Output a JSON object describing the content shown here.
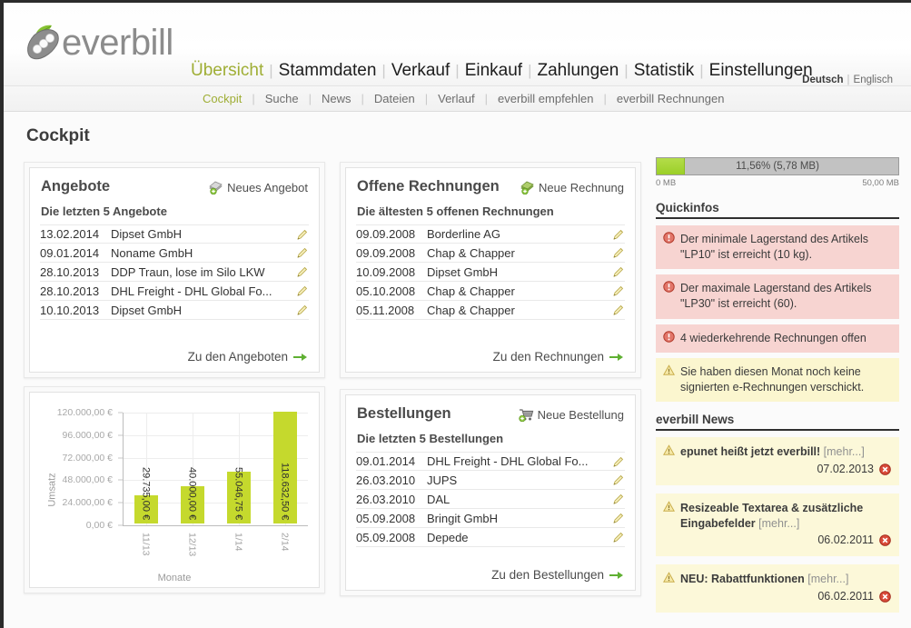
{
  "brand": {
    "logo_text": "everbill",
    "logo_icon": "pea-pod-logo-icon"
  },
  "header": {
    "main_nav": [
      {
        "label": "Übersicht",
        "active": true
      },
      {
        "label": "Stammdaten",
        "active": false
      },
      {
        "label": "Verkauf",
        "active": false
      },
      {
        "label": "Einkauf",
        "active": false
      },
      {
        "label": "Zahlungen",
        "active": false
      },
      {
        "label": "Statistik",
        "active": false
      },
      {
        "label": "Einstellungen",
        "active": false
      }
    ],
    "language": {
      "german": "Deutsch",
      "separator": "|",
      "english": "Englisch"
    }
  },
  "subnav": [
    {
      "label": "Cockpit",
      "active": true
    },
    {
      "label": "Suche",
      "active": false
    },
    {
      "label": "News",
      "active": false
    },
    {
      "label": "Dateien",
      "active": false
    },
    {
      "label": "Verlauf",
      "active": false
    },
    {
      "label": "everbill empfehlen",
      "active": false
    },
    {
      "label": "everbill Rechnungen",
      "active": false
    }
  ],
  "page": {
    "title": "Cockpit"
  },
  "panels": {
    "angebote": {
      "title": "Angebote",
      "action_label": "Neues Angebot",
      "action_icon": "new-offer-icon",
      "subtitle": "Die letzten 5 Angebote",
      "footer_label": "Zu den Angeboten",
      "footer_icon": "arrow-right-green-icon",
      "rows": [
        {
          "date": "13.02.2014",
          "name": "Dipset GmbH"
        },
        {
          "date": "09.01.2014",
          "name": "Noname GmbH"
        },
        {
          "date": "28.10.2013",
          "name": "DDP Traun, lose im Silo LKW"
        },
        {
          "date": "28.10.2013",
          "name": "DHL Freight - DHL Global Fo..."
        },
        {
          "date": "10.10.2013",
          "name": "Dipset GmbH"
        }
      ]
    },
    "offene_rechnungen": {
      "title": "Offene Rechnungen",
      "action_label": "Neue Rechnung",
      "action_icon": "new-invoice-icon",
      "subtitle": "Die ältesten 5 offenen Rechnungen",
      "footer_label": "Zu den Rechnungen",
      "footer_icon": "arrow-right-green-icon",
      "rows": [
        {
          "date": "09.09.2008",
          "name": "Borderline AG"
        },
        {
          "date": "09.09.2008",
          "name": "Chap & Chapper"
        },
        {
          "date": "10.09.2008",
          "name": "Dipset GmbH"
        },
        {
          "date": "05.10.2008",
          "name": "Chap & Chapper"
        },
        {
          "date": "05.11.2008",
          "name": "Chap & Chapper"
        }
      ]
    },
    "bestellungen": {
      "title": "Bestellungen",
      "action_label": "Neue Bestellung",
      "action_icon": "new-order-cart-icon",
      "subtitle": "Die letzten 5 Bestellungen",
      "footer_label": "Zu den Bestellungen",
      "footer_icon": "arrow-right-green-icon",
      "rows": [
        {
          "date": "09.01.2014",
          "name": "DHL Freight - DHL Global Fo..."
        },
        {
          "date": "26.03.2010",
          "name": "JUPS"
        },
        {
          "date": "26.03.2010",
          "name": "DAL"
        },
        {
          "date": "05.09.2008",
          "name": "Bringit GmbH"
        },
        {
          "date": "05.09.2008",
          "name": "Depede"
        }
      ]
    }
  },
  "storage": {
    "label": "11,56% (5,78 MB)",
    "percent": 11.56,
    "min_label": "0 MB",
    "max_label": "50,00 MB",
    "fill_color": "#9bcf27",
    "track_color": "#c2c2c2"
  },
  "quickinfos": {
    "heading": "Quickinfos",
    "items": [
      {
        "type": "error",
        "icon": "error-circle-icon",
        "text": "Der minimale Lagerstand des Artikels \"LP10\" ist erreicht (10 kg)."
      },
      {
        "type": "error",
        "icon": "error-circle-icon",
        "text": "Der maximale Lagerstand des Artikels \"LP30\" ist erreicht (60)."
      },
      {
        "type": "error",
        "icon": "error-circle-icon",
        "text": "4 wiederkehrende Rechnungen offen"
      },
      {
        "type": "warning",
        "icon": "warning-triangle-icon",
        "text": "Sie haben diesen Monat noch keine signierten e-Rechnungen verschickt."
      }
    ]
  },
  "news": {
    "heading": "everbill News",
    "more_label": "[mehr...]",
    "items": [
      {
        "icon": "warning-triangle-icon",
        "title": "epunet heißt jetzt everbill!",
        "date": "07.02.2013",
        "close_icon": "delete-circle-icon"
      },
      {
        "icon": "warning-triangle-icon",
        "title": "Resizeable Textarea & zusätzliche Eingabefelder",
        "date": "06.02.2011",
        "close_icon": "delete-circle-icon"
      },
      {
        "icon": "warning-triangle-icon",
        "title": "NEU: Rabattfunktionen",
        "date": "06.02.2011",
        "close_icon": "delete-circle-icon"
      }
    ]
  },
  "chart_data": {
    "type": "bar",
    "title": "",
    "xlabel": "Monate",
    "ylabel": "Umsatz",
    "categories": [
      "11/13",
      "12/13",
      "1/14",
      "2/14"
    ],
    "values": [
      29735.0,
      40000.0,
      55046.75,
      118632.5
    ],
    "data_labels": [
      "29.735,00 €",
      "40.000,00 €",
      "55.046,75 €",
      "118.632,50 €"
    ],
    "ylim": [
      0,
      120000
    ],
    "yticks": [
      0,
      24000,
      48000,
      72000,
      96000,
      120000
    ],
    "ytick_labels": [
      "0,00 €",
      "24.000,00 €",
      "48.000,00 €",
      "72.000,00 €",
      "96.000,00 €",
      "120.000,00 €"
    ],
    "grid": true,
    "legend": false,
    "bar_color": "#c5d92d"
  },
  "colors": {
    "accent_green": "#9fae35",
    "bar_green": "#c5d92d",
    "error_bg": "#f7d4d1",
    "warning_bg": "#fbf6cf",
    "news_bg": "#fcf8d9"
  }
}
